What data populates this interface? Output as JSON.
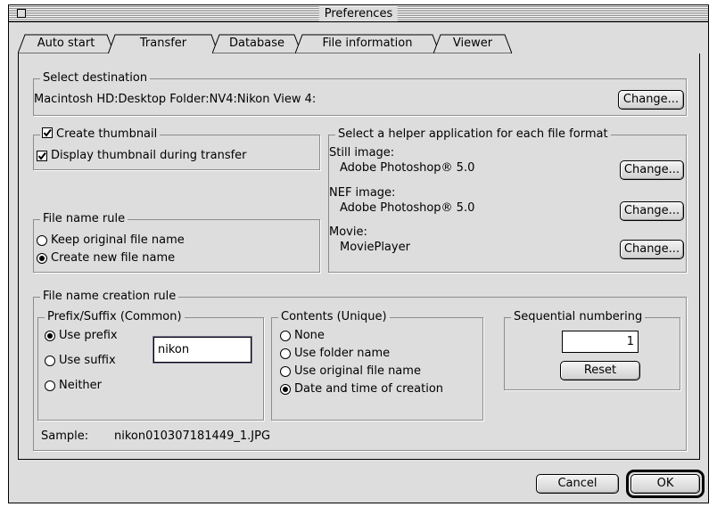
{
  "window": {
    "title": "Preferences"
  },
  "tabs": [
    {
      "label": "Auto start",
      "active": false
    },
    {
      "label": "Transfer",
      "active": true
    },
    {
      "label": "Database",
      "active": false
    },
    {
      "label": "File information",
      "active": false
    },
    {
      "label": "Viewer",
      "active": false
    }
  ],
  "destination": {
    "group_title": "Select destination",
    "path": "Macintosh HD:Desktop Folder:NV4:Nikon View 4:",
    "change_label": "Change..."
  },
  "thumbnail": {
    "create_label": "Create thumbnail",
    "create_checked": true,
    "display_label": "Display thumbnail during transfer",
    "display_checked": true
  },
  "helper": {
    "group_title": "Select a helper application for each file format",
    "items": [
      {
        "type": "Still image:",
        "app": "Adobe Photoshop® 5.0",
        "change_label": "Change..."
      },
      {
        "type": "NEF image:",
        "app": "Adobe Photoshop® 5.0",
        "change_label": "Change..."
      },
      {
        "type": "Movie:",
        "app": "MoviePlayer",
        "change_label": "Change..."
      }
    ]
  },
  "file_name_rule": {
    "group_title": "File name rule",
    "options": [
      {
        "label": "Keep original file name",
        "selected": false
      },
      {
        "label": "Create new file name",
        "selected": true
      }
    ]
  },
  "creation_rule": {
    "group_title": "File name creation rule",
    "prefix_suffix": {
      "group_title": "Prefix/Suffix (Common)",
      "options": [
        {
          "label": "Use prefix",
          "selected": true
        },
        {
          "label": "Use suffix",
          "selected": false
        },
        {
          "label": "Neither",
          "selected": false
        }
      ],
      "value": "nikon"
    },
    "contents": {
      "group_title": "Contents (Unique)",
      "options": [
        {
          "label": "None",
          "selected": false
        },
        {
          "label": "Use folder name",
          "selected": false
        },
        {
          "label": "Use original file name",
          "selected": false
        },
        {
          "label": "Date and time of creation",
          "selected": true
        }
      ]
    },
    "sequential": {
      "group_title": "Sequential numbering",
      "value": "1",
      "reset_label": "Reset"
    },
    "sample_label": "Sample:",
    "sample_value": "nikon010307181449_1.JPG"
  },
  "footer": {
    "cancel_label": "Cancel",
    "ok_label": "OK"
  }
}
